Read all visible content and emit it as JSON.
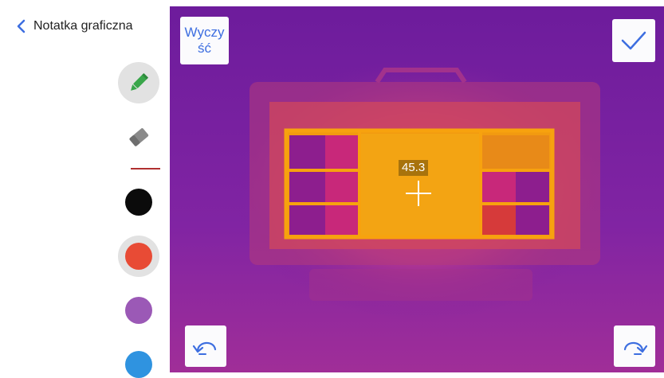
{
  "header": {
    "back_label": "Notatka graficzna"
  },
  "tools": [
    {
      "name": "pencil",
      "icon": "pencil-icon",
      "selected": true,
      "color": "#39a64a"
    },
    {
      "name": "eraser",
      "icon": "eraser-icon",
      "selected": false,
      "color": "#808080"
    }
  ],
  "separator_color": "#b03030",
  "palette": [
    {
      "color": "#0b0b0b",
      "selected": false
    },
    {
      "color": "#e84b35",
      "selected": true
    },
    {
      "color": "#9b59b6",
      "selected": false
    },
    {
      "color": "#2f93e0",
      "selected": false
    }
  ],
  "buttons": {
    "clear_line1": "Wyczy",
    "clear_line2": "ść",
    "confirm_icon": "checkmark-icon",
    "undo_icon": "undo-icon",
    "redo_icon": "redo-icon"
  },
  "measurement": {
    "value": "45.3"
  },
  "accent_color": "#3d6ee0"
}
